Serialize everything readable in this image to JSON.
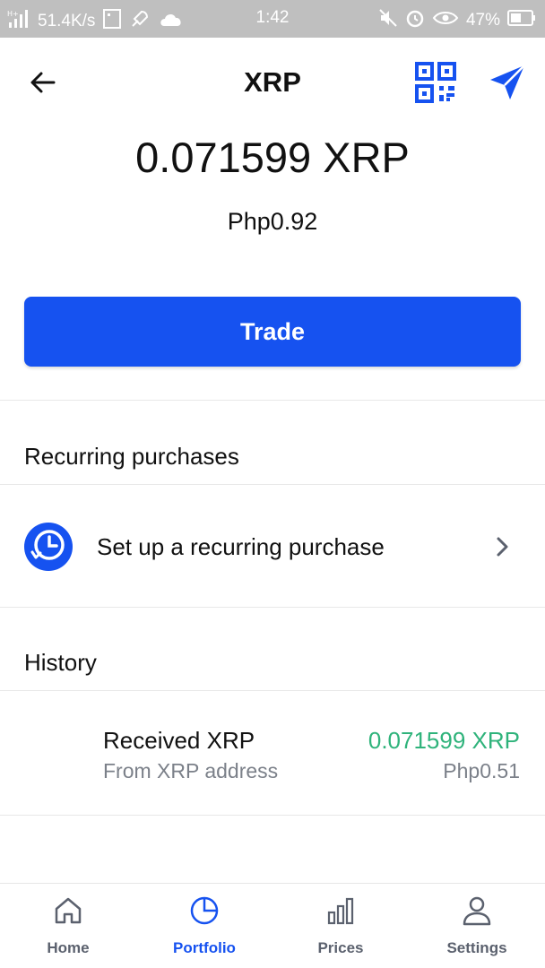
{
  "status_bar": {
    "network": "51.4K/s",
    "time": "1:42",
    "battery": "47%",
    "signal_label": "H+"
  },
  "header": {
    "title": "XRP"
  },
  "balance": {
    "crypto": "0.071599 XRP",
    "fiat": "Php0.92"
  },
  "trade": {
    "label": "Trade"
  },
  "recurring": {
    "heading": "Recurring purchases",
    "action_label": "Set up a recurring purchase"
  },
  "history": {
    "heading": "History",
    "items": [
      {
        "title": "Received XRP",
        "subtitle": "From XRP address",
        "amount": "0.071599 XRP",
        "fiat": "Php0.51"
      }
    ]
  },
  "nav": {
    "items": [
      {
        "label": "Home",
        "icon": "home-icon"
      },
      {
        "label": "Portfolio",
        "icon": "portfolio-icon"
      },
      {
        "label": "Prices",
        "icon": "prices-icon"
      },
      {
        "label": "Settings",
        "icon": "settings-icon"
      }
    ],
    "active": "Portfolio"
  },
  "colors": {
    "accent": "#1652f0",
    "positive": "#2fb37b",
    "muted": "#7b8089",
    "status_bar": "#bfbfbf"
  }
}
